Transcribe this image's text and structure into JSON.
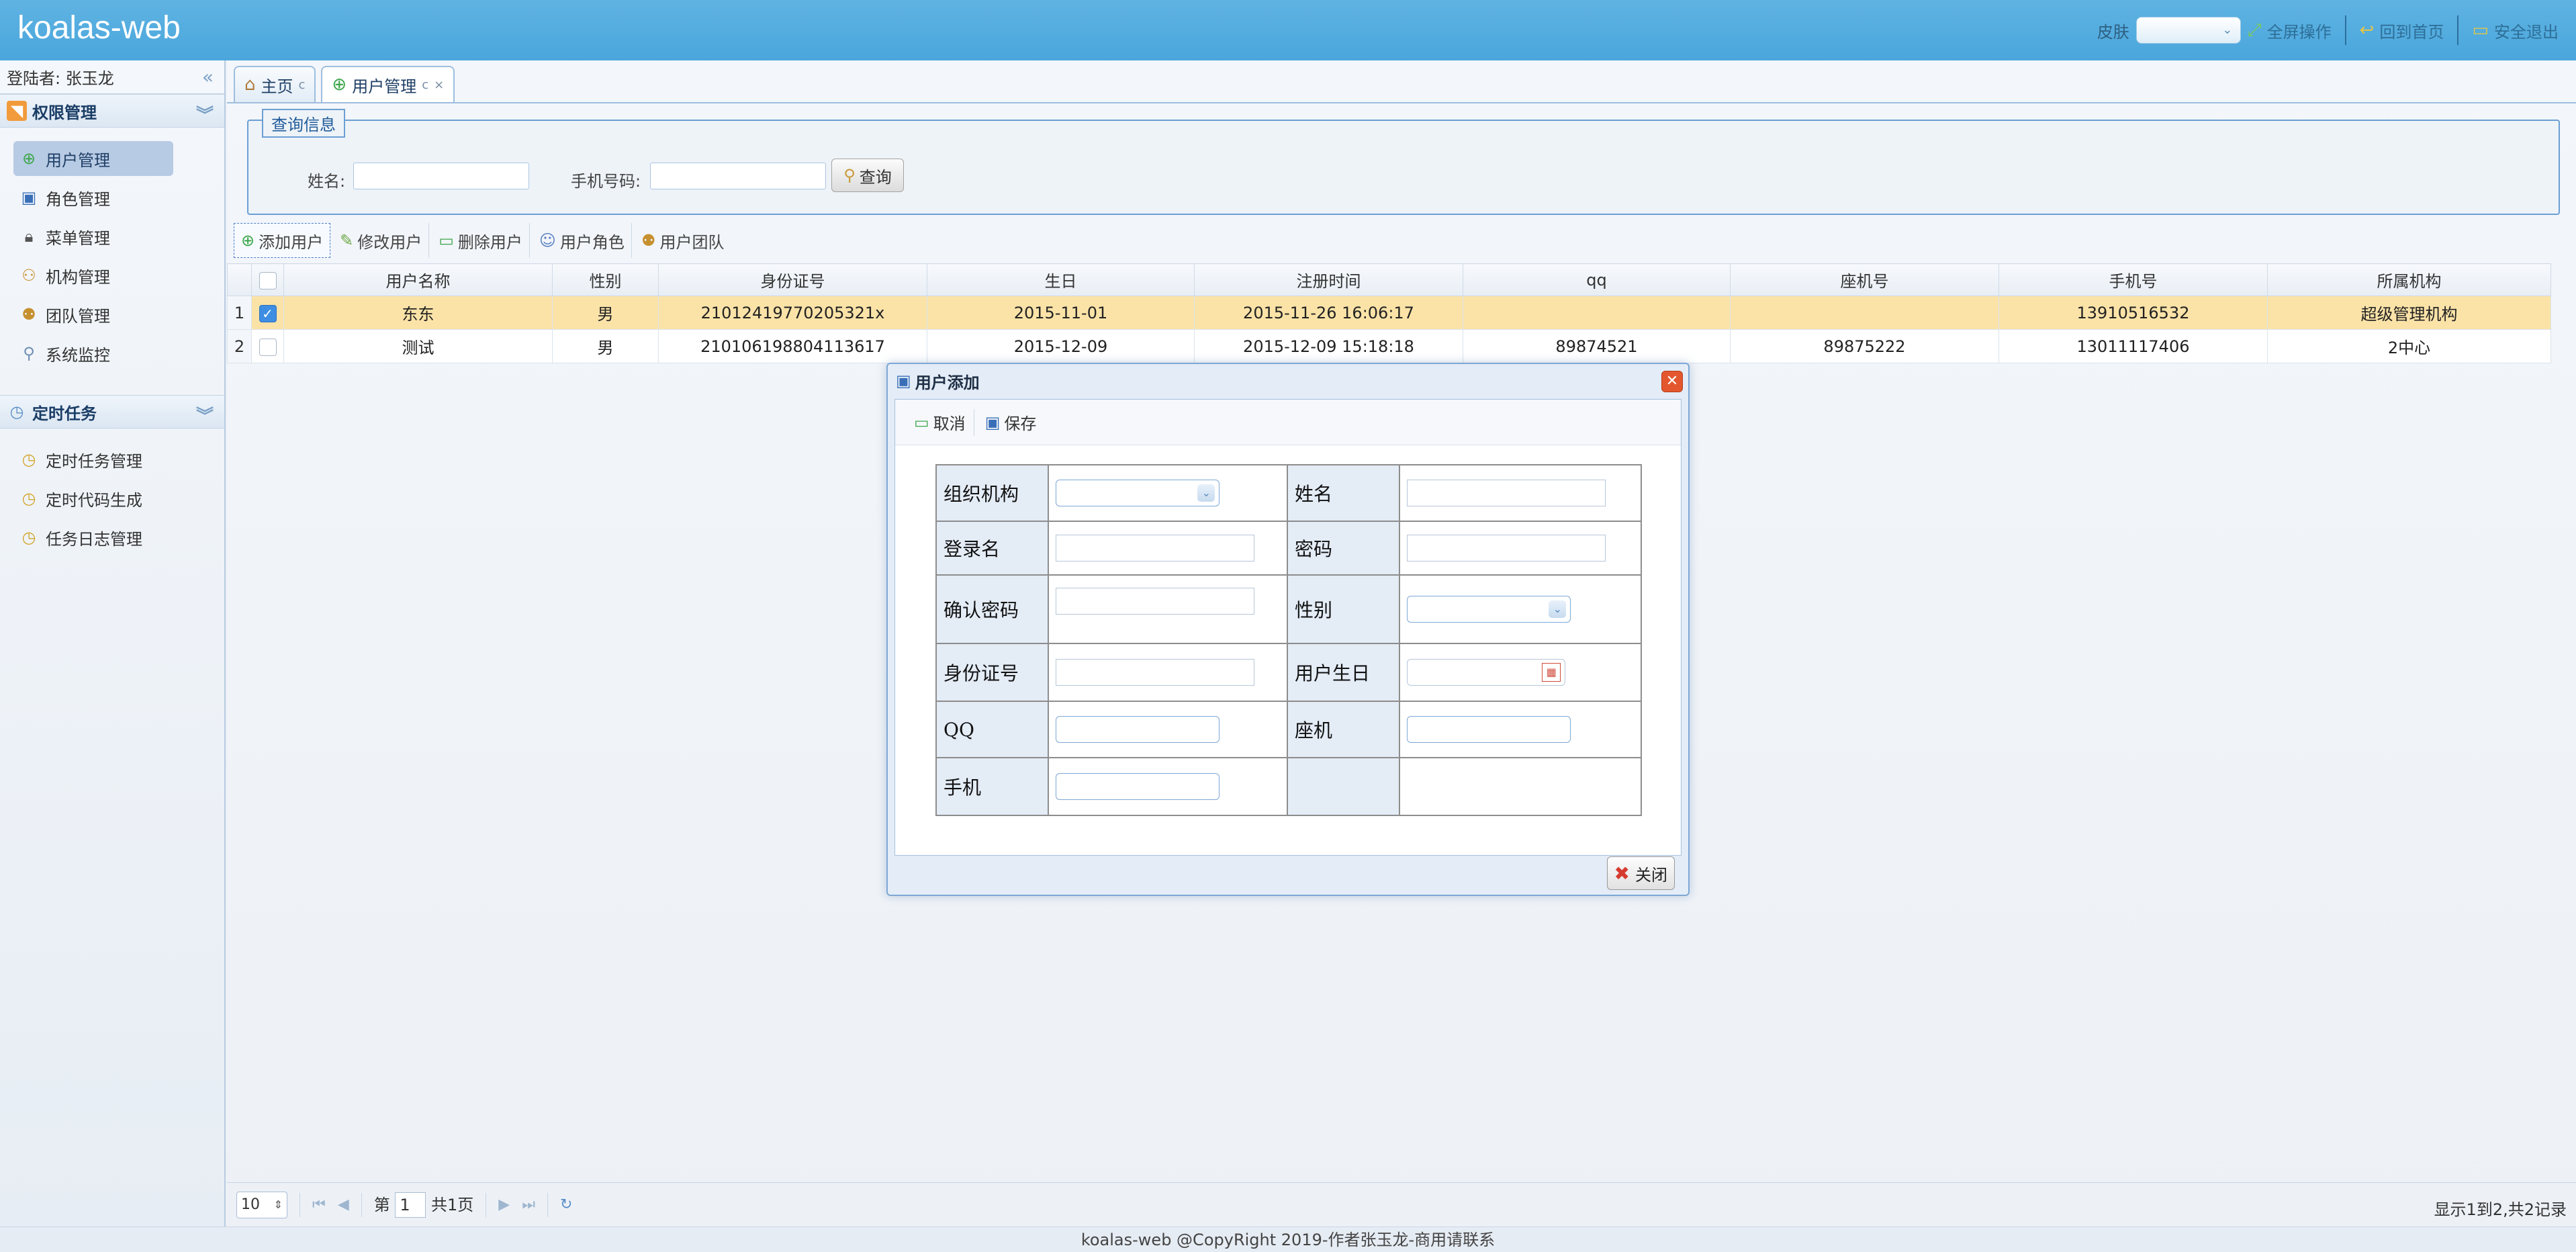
{
  "header": {
    "logo": "koalas-web",
    "skin_label": "皮肤",
    "fullscreen_label": "全屏操作",
    "home_label": "回到首页",
    "logout_label": "安全退出"
  },
  "sidebar": {
    "login_text": "登陆者: 张玉龙",
    "sections": [
      {
        "title": "权限管理",
        "items": [
          {
            "label": "用户管理",
            "icon": "add-icon",
            "active": true
          },
          {
            "label": "角色管理",
            "icon": "save-icon"
          },
          {
            "label": "菜单管理",
            "icon": "lock-icon"
          },
          {
            "label": "机构管理",
            "icon": "org-icon"
          },
          {
            "label": "团队管理",
            "icon": "team-icon"
          },
          {
            "label": "系统监控",
            "icon": "search-icon"
          }
        ]
      },
      {
        "title": "定时任务",
        "items": [
          {
            "label": "定时任务管理",
            "icon": "clock-icon"
          },
          {
            "label": "定时代码生成",
            "icon": "clock-icon"
          },
          {
            "label": "任务日志管理",
            "icon": "clock-icon"
          }
        ]
      }
    ]
  },
  "tabs": [
    {
      "label": "主页",
      "icon": "home-icon"
    },
    {
      "label": "用户管理",
      "icon": "add-icon",
      "active": true
    }
  ],
  "query": {
    "legend": "查询信息",
    "name_label": "姓名:",
    "phone_label": "手机号码:",
    "search_label": "查询"
  },
  "toolbar": {
    "add_user": "添加用户",
    "edit_user": "修改用户",
    "delete_user": "删除用户",
    "user_role": "用户角色",
    "user_team": "用户团队"
  },
  "grid": {
    "columns": [
      "用户名称",
      "性别",
      "身份证号",
      "生日",
      "注册时间",
      "qq",
      "座机号",
      "手机号",
      "所属机构"
    ],
    "rows": [
      {
        "index": "1",
        "checked": true,
        "cells": [
          "东东",
          "男",
          "21012419770205321x",
          "2015-11-01",
          "2015-11-26 16:06:17",
          "",
          "",
          "13910516532",
          "超级管理机构"
        ]
      },
      {
        "index": "2",
        "checked": false,
        "cells": [
          "测试",
          "男",
          "210106198804113617",
          "2015-12-09",
          "2015-12-09 15:18:18",
          "89874521",
          "89875222",
          "13011117406",
          "2中心"
        ]
      }
    ]
  },
  "pager": {
    "page_size": "10",
    "page_prefix": "第",
    "page_value": "1",
    "page_total": "共1页",
    "info": "显示1到2,共2记录"
  },
  "footer": {
    "text": "koalas-web @CopyRight 2019-作者张玉龙-商用请联系"
  },
  "dialog": {
    "title": "用户添加",
    "cancel_label": "取消",
    "save_label": "保存",
    "close_label": "关闭",
    "fields": {
      "org": "组织机构",
      "name": "姓名",
      "login": "登录名",
      "password": "密码",
      "confirm": "确认密码",
      "gender": "性别",
      "idcard": "身份证号",
      "birthday": "用户生日",
      "qq": "QQ",
      "phone_fixed": "座机",
      "mobile": "手机"
    }
  },
  "colors": {
    "header_bg": "#4aa6dc",
    "selected_row": "#fbe3a8",
    "active_menu": "#b8cbe4",
    "close_red": "#e4572e"
  }
}
